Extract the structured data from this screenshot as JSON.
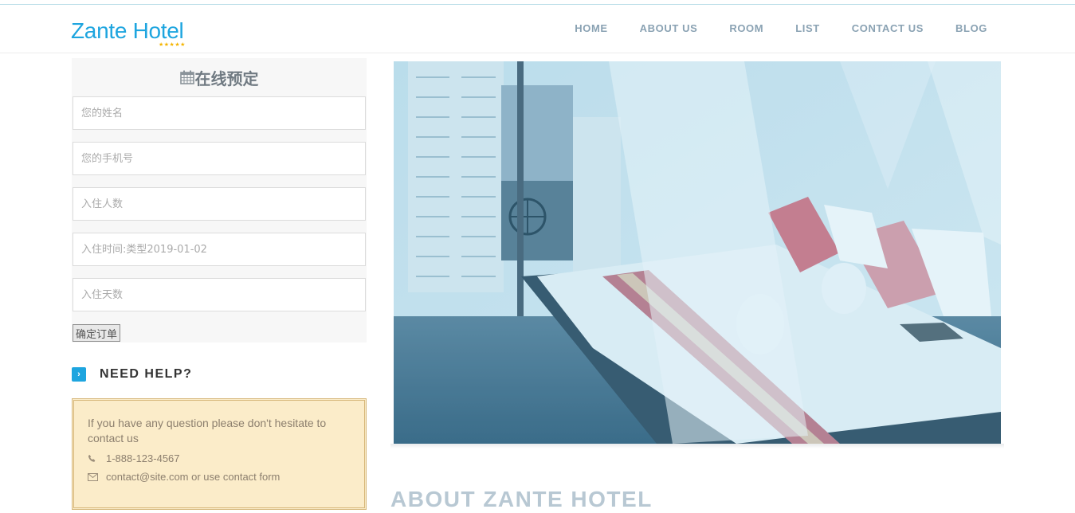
{
  "brand": {
    "name": "Zante Hotel",
    "stars": "★★★★★"
  },
  "nav": {
    "items": [
      {
        "label": "HOME"
      },
      {
        "label": "ABOUT US"
      },
      {
        "label": "ROOM"
      },
      {
        "label": "LIST"
      },
      {
        "label": "CONTACT US"
      },
      {
        "label": "BLOG"
      }
    ]
  },
  "booking": {
    "icon": "calendar-icon",
    "title": "在线预定",
    "fields": {
      "name": {
        "placeholder": "您的姓名",
        "value": ""
      },
      "phone": {
        "placeholder": "您的手机号",
        "value": ""
      },
      "guests": {
        "placeholder": "入住人数",
        "value": ""
      },
      "checkin": {
        "placeholder": "入住时间:类型2019-01-02",
        "value": ""
      },
      "days": {
        "placeholder": "入住天数",
        "value": ""
      }
    },
    "submit_label": "确定订单"
  },
  "help": {
    "icon": "chevron-right-icon",
    "title": "NEED HELP?",
    "text": "If you have any question please don't hesitate to contact us",
    "phone_icon": "phone-icon",
    "phone": "1-888-123-4567",
    "email_icon": "envelope-icon",
    "email": "contact@site.com or use contact form"
  },
  "hero": {
    "image": "hotel-room-canopy-bed-photo"
  },
  "about": {
    "heading": "ABOUT ZANTE HOTEL"
  },
  "colors": {
    "brand": "#1ea5df",
    "nav_text": "#8aa2b3",
    "help_bg": "#fbecc9",
    "help_border": "#d6b77a"
  }
}
